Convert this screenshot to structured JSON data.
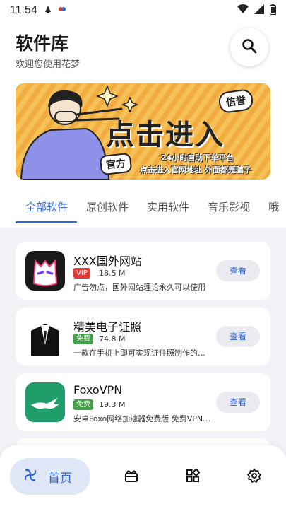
{
  "status_bar": {
    "time": "11:54",
    "left_icons": [
      "app-notification-icon",
      "app-notification-icon-2"
    ],
    "right_icons": [
      "wifi-icon",
      "signal-icon",
      "battery-icon"
    ]
  },
  "header": {
    "title": "软件库",
    "subtitle": "欢迎您使用花梦"
  },
  "banner": {
    "main_text": "点击进入",
    "tag_trust": "信誉",
    "tag_official": "官方",
    "line1": "24小时自助下单平台",
    "line2": "点击进入官网地址 外面都是骗子"
  },
  "tabs": [
    {
      "label": "全部软件",
      "active": true
    },
    {
      "label": "原创软件",
      "active": false
    },
    {
      "label": "实用软件",
      "active": false
    },
    {
      "label": "音乐影视",
      "active": false
    },
    {
      "label": "哦",
      "active": false
    }
  ],
  "apps": [
    {
      "name": "XXX国外网站",
      "badge": "VIP",
      "badge_color": "#e53935",
      "size": "18.5 M",
      "desc": "广告勿点，国外网站理论永久可以使用",
      "button": "查看"
    },
    {
      "name": "精美电子证照",
      "badge": "免费",
      "badge_color": "#43a047",
      "size": "74.8 M",
      "desc": "一款在手机上即可实现证件照制作的软件",
      "button": "查看"
    },
    {
      "name": "FoxoVPN",
      "badge": "免费",
      "badge_color": "#43a047",
      "size": "19.3 M",
      "desc": "安卓Foxo网络加速器免费版 免费VPN加速器",
      "button": "查看"
    }
  ],
  "bottom_nav": {
    "home_label": "首页",
    "items": [
      "home-icon",
      "gift-icon",
      "apps-icon",
      "settings-icon"
    ]
  },
  "colors": {
    "accent": "#2f66d8",
    "background": "#f2f3f7"
  }
}
